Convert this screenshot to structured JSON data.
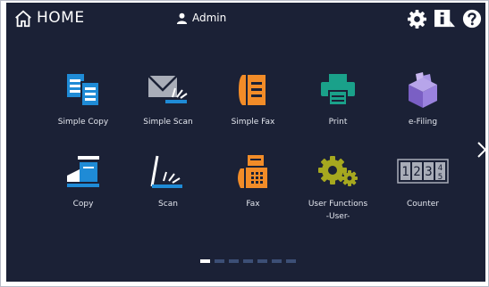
{
  "header": {
    "home_label": "HOME",
    "user_name": "Admin",
    "home_icon": "home-icon",
    "user_icon": "user-icon",
    "settings_icon": "gear-icon",
    "info_icon": "info-icon",
    "help_icon": "help-icon"
  },
  "apps": [
    {
      "label": "Simple Copy",
      "icon": "simple-copy-icon"
    },
    {
      "label": "Simple Scan",
      "icon": "simple-scan-icon"
    },
    {
      "label": "Simple Fax",
      "icon": "simple-fax-icon"
    },
    {
      "label": "Print",
      "icon": "printer-icon"
    },
    {
      "label": "e-Filing",
      "icon": "e-filing-icon"
    },
    {
      "label": "Copy",
      "icon": "copier-icon"
    },
    {
      "label": "Scan",
      "icon": "scanner-icon"
    },
    {
      "label": "Fax",
      "icon": "fax-icon"
    },
    {
      "label": "User Functions",
      "sublabel": "-User-",
      "icon": "user-functions-icon"
    },
    {
      "label": "Counter",
      "icon": "counter-icon"
    }
  ],
  "pager": {
    "pages": 7,
    "current": 1
  },
  "colors": {
    "background": "#1b2136",
    "accent_blue": "#1f8bd6",
    "accent_orange": "#f28c28",
    "accent_green": "#1aa18a",
    "accent_purple": "#7a5fc4",
    "accent_olive": "#a6a81f",
    "accent_grey": "#a9adb8"
  }
}
